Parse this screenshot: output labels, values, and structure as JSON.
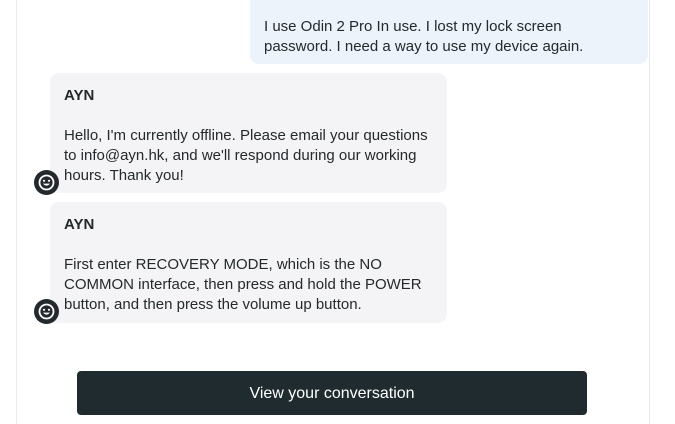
{
  "conversation": {
    "messages": [
      {
        "role": "user",
        "text": "I use Odin 2 Pro In use. I lost my lock screen password. I need a way to use my device again."
      },
      {
        "role": "agent",
        "sender": "AYN",
        "text": "Hello, I'm currently offline. Please email your questions to info@ayn.hk, and we'll respond during our working hours. Thank you!",
        "avatar_icon": "smiley-face-icon"
      },
      {
        "role": "agent",
        "sender": "AYN",
        "text": "First enter RECOVERY MODE, which is the NO COMMON interface, then press and hold the POWER button, and then press the volume up button.",
        "avatar_icon": "smiley-face-icon"
      }
    ]
  },
  "cta": {
    "label": "View your conversation"
  },
  "colors": {
    "user_bubble": "#ecf3fa",
    "agent_bubble": "#f4f4f6",
    "button_bg": "#1f2b2e",
    "avatar_bg": "#23292d"
  }
}
